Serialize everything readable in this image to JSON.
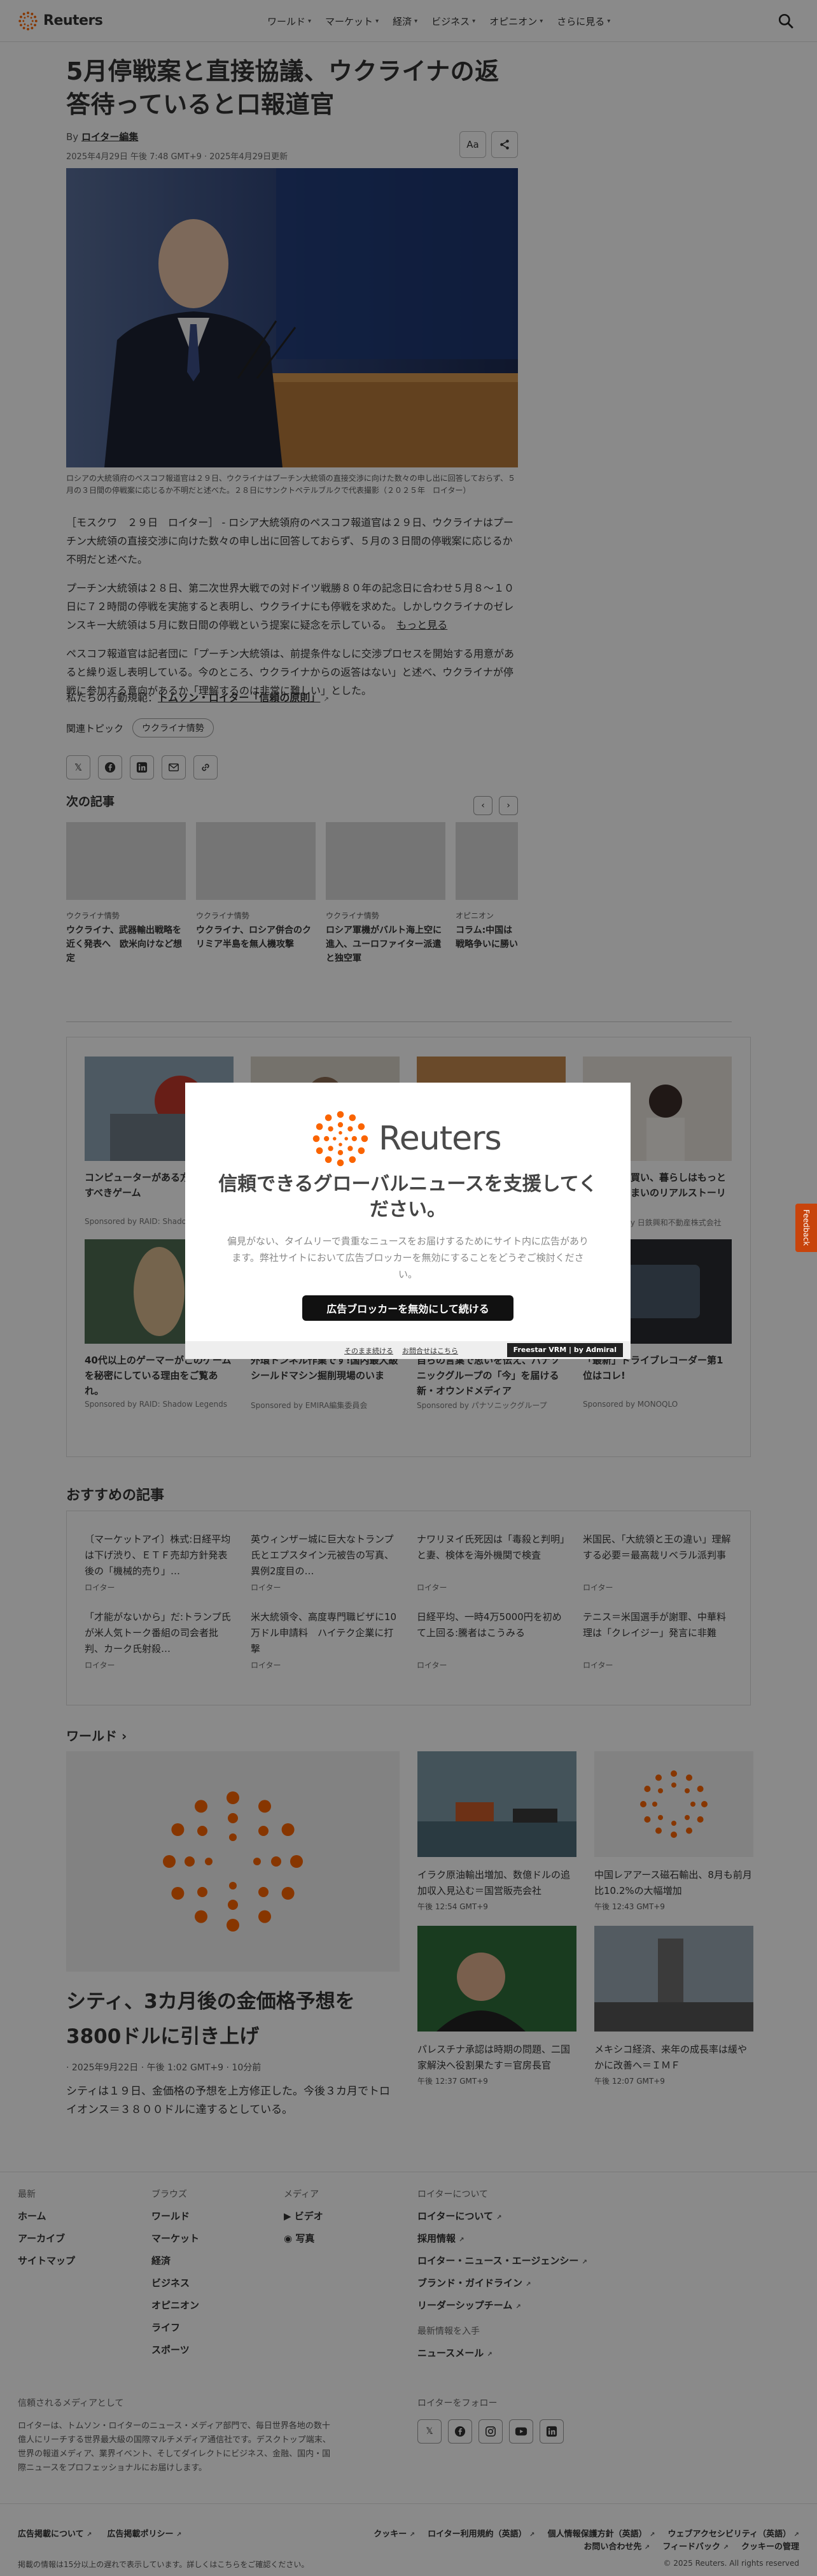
{
  "nav": {
    "logo": "Reuters",
    "links": [
      "ワールド",
      "マーケット",
      "経済",
      "ビジネス",
      "オピニオン",
      "さらに見る"
    ]
  },
  "article": {
    "headline": "5月停戦案と直接協議、ウクライナの返答待っていると口報道官",
    "byline_prefix": "By",
    "author": "ロイター編集",
    "dateline": "2025年4月29日 午後 7:48 GMT+9 · 2025年4月29日更新",
    "text_size_btn": "Aa",
    "caption": "ロシアの大統領府のペスコフ報道官は２９日、ウクライナはプーチン大統領の直接交渉に向けた数々の申し出に回答しておらず、５月の３日間の停戦案に応じるか不明だと述べた。２８日にサンクトペテルブルクで代表撮影（２０２５年　ロイター）",
    "paragraphs": [
      "［モスクワ　２９日　ロイター］ - ロシア大統領府のペスコフ報道官は２９日、ウクライナはプーチン大統領の直接交渉に向けた数々の申し出に回答しておらず、５月の３日間の停戦案に応じるか不明だと述べた。",
      "プーチン大統領は２８日、第二次世界大戦での対ドイツ戦勝８０年の記念日に合わせ５月８～１０日に７２時間の停戦を実施すると表明し、ウクライナにも停戦を求めた。しかしウクライナのゼレンスキー大統領は５月に数日間の停戦という提案に疑念を示している。",
      "ペスコフ報道官は記者団に「プーチン大統領は、前提条件なしに交渉プロセスを開始する用意があると繰り返し表明している。今のところ、ウクライナからの返答はない」と述べ、ウクライナが停戦に参加する意向があるか「理解するのは非常に難しい」とした。"
    ],
    "more_link": "もっと見る",
    "principles_prefix": "私たちの行動規範：",
    "principles_link": "トムソン・ロイター「信頼の原則」",
    "topics_label": "関連トピック",
    "topic": "ウクライナ情勢",
    "share_icons": [
      "x-icon",
      "facebook-icon",
      "linkedin-icon",
      "mail-icon",
      "link-icon"
    ]
  },
  "next": {
    "title": "次の記事",
    "cards": [
      {
        "kicker": "ウクライナ情勢",
        "title": "ウクライナ、武器輸出戦略を近く発表へ　欧米向けなど想定"
      },
      {
        "kicker": "ウクライナ情勢",
        "title": "ウクライナ、ロシア併合のクリミア半島を無人機攻撃"
      },
      {
        "kicker": "ウクライナ情勢",
        "title": "ロシア軍機がバルト海上空に進入、ユーロファイター派遣と独空軍"
      },
      {
        "kicker": "オピニオン",
        "title": "コラム:中国は戦略争いに勝い"
      }
    ]
  },
  "sponsored": [
    {
      "title": "コンピューターがある方は絶対試すべきゲーム",
      "source": "Sponsored by RAID: Shadow Legends"
    },
    {
      "title": "",
      "source": ""
    },
    {
      "title": "",
      "source": ""
    },
    {
      "title": "安心で家を買い、暮らしはもっと豊かに。住まいのリアルストーリー",
      "source": "Sponsored by 日鉄興和不動産株式会社"
    },
    {
      "title": "40代以上のゲーマーがこのゲームを秘密にしている理由をご覧あれ。",
      "source": "Sponsored by RAID: Shadow Legends"
    },
    {
      "title": "外環トンネル作業です!国内最大級シールドマシン掘削現場のいま",
      "source": "Sponsored by EMIRA編集委員会"
    },
    {
      "title": "自らの言葉で思いを伝え、パナソニックグループの「今」を届ける新・オウンドメディア",
      "source": "Sponsored by パナソニックグループ"
    },
    {
      "title": "「最新」ドライブレコーダー第1位はコレ!",
      "source": "Sponsored by MONOQLO"
    }
  ],
  "modal": {
    "logo": "Reuters",
    "title": "信頼できるグローバルニュースを支援してください。",
    "text": "偏見がない、タイムリーで貴重なニュースをお届けするためにサイト内に広告があります。弊社サイトにおいて広告ブロッカーを無効にすることをどうぞご検討ください。",
    "cta": "広告ブロッカーを無効にして続ける",
    "link1": "そのまま続ける",
    "link2": "お問合せはこちら",
    "brand": "Freestar VRM  |  by Admiral"
  },
  "feedback": "Feedback",
  "recommended": {
    "title": "おすすめの記事",
    "items": [
      {
        "title": "〔マーケットアイ〕株式:日経平均は下げ渋り、ＥＴＦ売却方針発表後の「機械的売り」…",
        "source": "ロイター"
      },
      {
        "title": "英ウィンザー城に巨大なトランプ氏とエプスタイン元被告の写真、異例2度目の…",
        "source": "ロイター"
      },
      {
        "title": "ナワリヌイ氏死因は「毒殺と判明」と妻、検体を海外機関で検査",
        "source": "ロイター"
      },
      {
        "title": "米国民、「大統領と王の違い」理解する必要＝最高裁リベラル派判事",
        "source": "ロイター"
      },
      {
        "title": "「才能がないから」だ:トランプ氏が米人気トーク番組の司会者批判、カーク氏射殺…",
        "source": "ロイター"
      },
      {
        "title": "米大統領令、高度専門職ビザに10万ドル申請料　ハイテク企業に打撃",
        "source": "ロイター"
      },
      {
        "title": "日経平均、一時4万5000円を初めて上回る:騰者はこうみる",
        "source": "ロイター"
      },
      {
        "title": "テニス＝米国選手が謝罪、中華料理は「クレイジー」発言に非難",
        "source": "ロイター"
      }
    ]
  },
  "world": {
    "title": "ワールド",
    "headline": "シティ、3カ月後の金価格予想を3800ドルに引き上げ",
    "date": "· 2025年9月22日 · 午後 1:02 GMT+9 · 10分前",
    "desc": "シティは１９日、金価格の予想を上方修正した。今後３カ月でトロイオンス＝３８００ドルに達するとしている。",
    "items": [
      {
        "title": "イラク原油輸出増加、数億ドルの追加収入見込む＝国営販売会社",
        "time": "午後 12:54 GMT+9"
      },
      {
        "title": "中国レアアース磁石輸出、8月も前月比10.2%の大幅増加",
        "time": "午後 12:43 GMT+9"
      },
      {
        "title": "パレスチナ承認は時期の問題、二国家解決へ役割果たす＝官房長官",
        "time": "午後 12:37 GMT+9"
      },
      {
        "title": "メキシコ経済、来年の成長率は緩やかに改善へ＝ＩＭＦ",
        "time": "午後 12:07 GMT+9"
      }
    ]
  },
  "footer": {
    "col1": {
      "heading": "最新",
      "items": [
        "ホーム",
        "アーカイブ",
        "サイトマップ"
      ]
    },
    "col2": {
      "heading": "ブラウズ",
      "items": [
        "ワールド",
        "マーケット",
        "経済",
        "ビジネス",
        "オピニオン",
        "ライフ",
        "スポーツ"
      ]
    },
    "col3": {
      "heading": "メディア",
      "items": [
        "ビデオ",
        "写真"
      ]
    },
    "col4": {
      "heading": "ロイターについて",
      "items": [
        "ロイターについて",
        "採用情報",
        "ロイター・ニュース・エージェンシー",
        "ブランド・ガイドライン",
        "リーダーシップチーム"
      ]
    },
    "col4b": {
      "heading": "最新情報を入手",
      "items": [
        "ニュースメール"
      ]
    },
    "trusted_heading": "信頼されるメディアとして",
    "trusted_text": "ロイターは、トムソン・ロイターのニュース・メディア部門で、毎日世界各地の数十億人にリーチする世界最大級の国際マルチメディア通信社です。デスクトップ端末、世界の報道メディア、業界イベント、そしてダイレクトにビジネス、金融、国内・国際ニュースをプロフェッショナルにお届けします。",
    "follow_heading": "ロイターをフォロー",
    "legal_left": [
      "広告掲載について",
      "広告掲載ポリシー"
    ],
    "legal_right": [
      "クッキー",
      "ロイター利用規約（英語）",
      "個人情報保護方針（英語）",
      "ウェブアクセシビリティ（英語）",
      "お問い合わせ先",
      "フィードバック",
      "クッキーの管理"
    ],
    "note": "掲載の情報は15分以上の遅れで表示しています。詳しくはこちらをご確認ください。",
    "copyright": "© 2025 Reuters. All rights reserved"
  }
}
